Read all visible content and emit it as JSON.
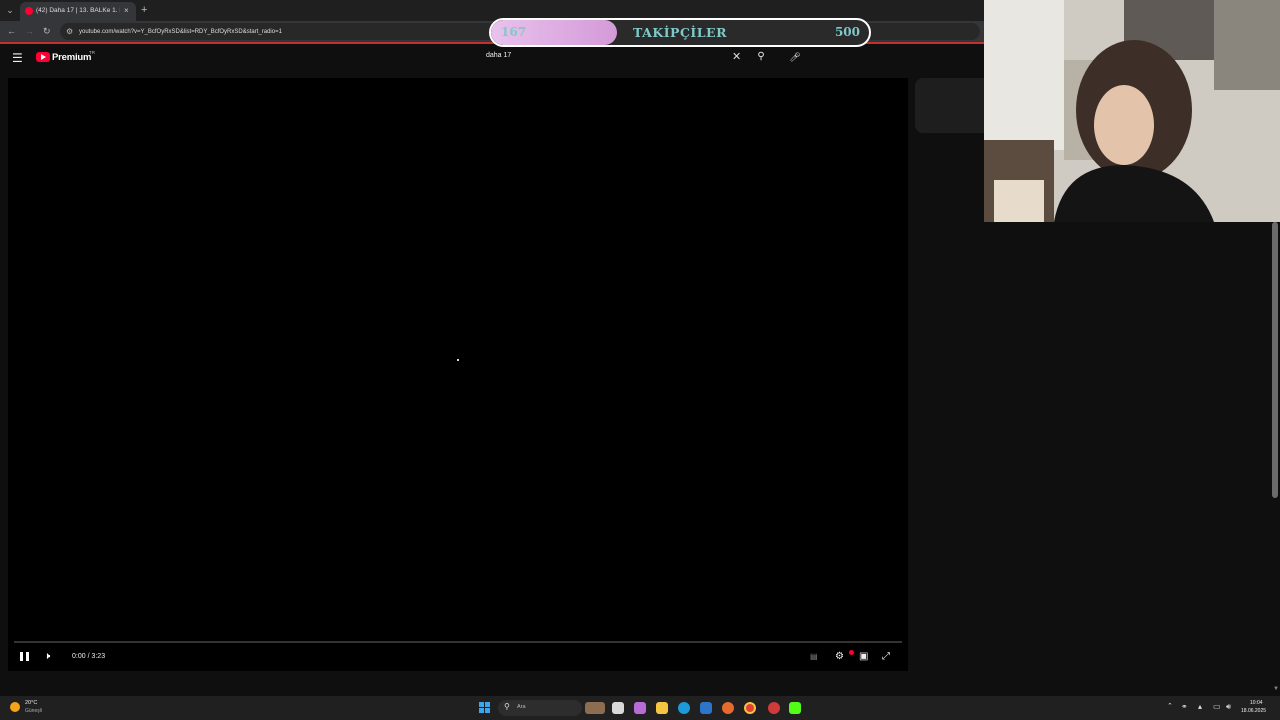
{
  "browser": {
    "tab_title": "(42) Daha 17 | 13. BALKe 1. Röy",
    "tab_close": "×",
    "new_tab": "+",
    "url": "youtube.com/watch?v=Y_BcfOyRxSD&list=RDY_BcfOyRxSD&start_radio=1"
  },
  "followers_overlay": {
    "current": "167",
    "label": "TAKİPÇİLER",
    "goal": "500",
    "progress_fraction": 0.334
  },
  "youtube": {
    "logo_text": "Premium",
    "region": "TR",
    "search_query": "daha 17",
    "search_clear": "✕"
  },
  "player": {
    "time": "0:00 / 3:23",
    "state": "playing"
  },
  "taskbar": {
    "weather_temp": "20°C",
    "weather_desc": "Güneşli",
    "search_placeholder": "Ara",
    "clock_time": "10:04",
    "clock_date": "18.06.2025"
  },
  "colors": {
    "youtube_red": "#ff0033",
    "overlay_fill": "#d49ad8",
    "overlay_text": "#7fc9c8",
    "background": "#0f0f0f"
  }
}
